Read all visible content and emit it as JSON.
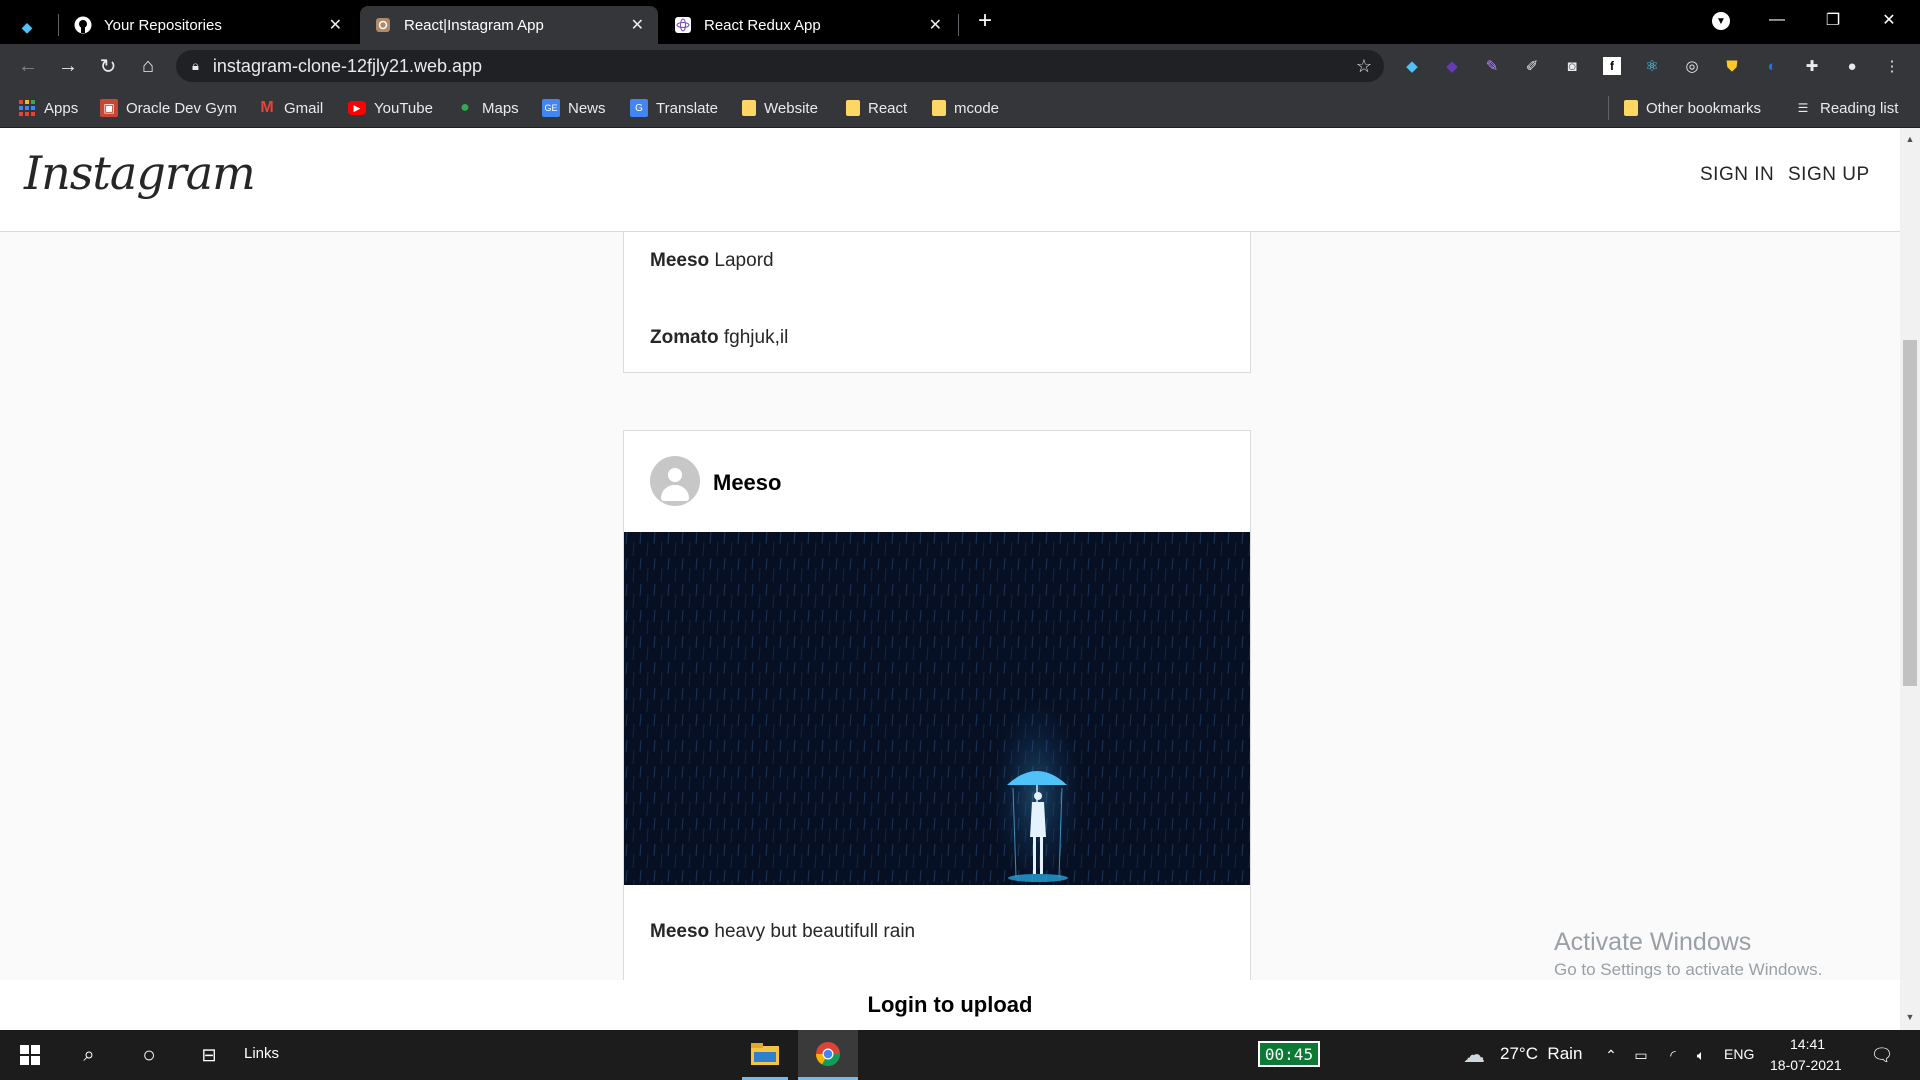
{
  "browser": {
    "tabs": [
      {
        "title": "Your Repositories",
        "icon": "github-icon"
      },
      {
        "title": "React|Instagram App",
        "icon": "instagram-icon"
      },
      {
        "title": "React Redux App",
        "icon": "react-icon"
      }
    ],
    "url": "instagram-clone-12fjly21.web.app",
    "bookmarks": [
      {
        "label": "Apps",
        "icon": "apps-grid-icon"
      },
      {
        "label": "Oracle Dev Gym",
        "icon": "oracle-icon"
      },
      {
        "label": "Gmail",
        "icon": "gmail-icon"
      },
      {
        "label": "YouTube",
        "icon": "youtube-icon"
      },
      {
        "label": "Maps",
        "icon": "maps-icon"
      },
      {
        "label": "News",
        "icon": "news-icon"
      },
      {
        "label": "Translate",
        "icon": "translate-icon"
      },
      {
        "label": "Website",
        "icon": "folder-icon"
      },
      {
        "label": "React",
        "icon": "folder-icon"
      },
      {
        "label": "mcode",
        "icon": "folder-icon"
      }
    ],
    "other_bookmarks": "Other bookmarks",
    "reading_list": "Reading list"
  },
  "app": {
    "logo": "Instagram",
    "sign_in": "SIGN IN",
    "sign_up": "SIGN UP",
    "previous_post": {
      "comments": [
        {
          "user": "Meeso",
          "text": "Lapord"
        },
        {
          "user": "Zomato",
          "text": "fghjuk,il"
        }
      ]
    },
    "post": {
      "username": "Meeso",
      "caption_user": "Meeso",
      "caption_text": "heavy but beautifull rain"
    },
    "upload_prompt": "Login to upload"
  },
  "watermark": {
    "line1": "Activate Windows",
    "line2": "Go to Settings to activate Windows."
  },
  "taskbar": {
    "links_label": "Links",
    "timer": "00:45",
    "weather": "27°C  Rain",
    "language": "ENG",
    "time": "14:41",
    "date": "18-07-2021"
  },
  "colors": {
    "accent_tab_bg": "#35363a",
    "page_bg": "#fafafa",
    "card_border": "#dbdbdb",
    "timer_bg": "#0c7a34"
  }
}
